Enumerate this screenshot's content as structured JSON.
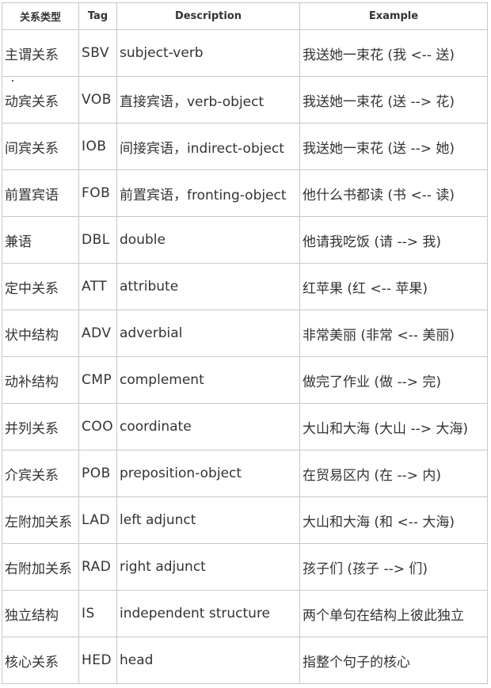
{
  "headers": {
    "name": "关系类型",
    "tag": "Tag",
    "description": "Description",
    "example": "Example"
  },
  "rows": [
    {
      "name": "主谓关系",
      "tag": "SBV",
      "description": "subject-verb",
      "example": "我送她一束花 (我 <-- 送)"
    },
    {
      "name": "动宾关系",
      "tag": "VOB",
      "description": "直接宾语，verb-object",
      "example": "我送她一束花 (送 --> 花)"
    },
    {
      "name": "间宾关系",
      "tag": "IOB",
      "description": "间接宾语，indirect-object",
      "example": "我送她一束花 (送 --> 她)"
    },
    {
      "name": "前置宾语",
      "tag": "FOB",
      "description": "前置宾语，fronting-object",
      "example": "他什么书都读 (书 <-- 读)"
    },
    {
      "name": "兼语",
      "tag": "DBL",
      "description": "double",
      "example": "他请我吃饭 (请 --> 我)"
    },
    {
      "name": "定中关系",
      "tag": "ATT",
      "description": "attribute",
      "example": "红苹果 (红 <-- 苹果)"
    },
    {
      "name": "状中结构",
      "tag": "ADV",
      "description": "adverbial",
      "example": "非常美丽 (非常 <-- 美丽)"
    },
    {
      "name": "动补结构",
      "tag": "CMP",
      "description": "complement",
      "example": "做完了作业 (做 --> 完)"
    },
    {
      "name": "并列关系",
      "tag": "COO",
      "description": "coordinate",
      "example": "大山和大海 (大山 --> 大海)"
    },
    {
      "name": "介宾关系",
      "tag": "POB",
      "description": "preposition-object",
      "example": "在贸易区内 (在 --> 内)"
    },
    {
      "name": "左附加关系",
      "tag": "LAD",
      "description": "left adjunct",
      "example": "大山和大海 (和 <-- 大海)"
    },
    {
      "name": "右附加关系",
      "tag": "RAD",
      "description": "right adjunct",
      "example": "孩子们 (孩子 --> 们)"
    },
    {
      "name": "独立结构",
      "tag": "IS",
      "description": "independent structure",
      "example": "两个单句在结构上彼此独立"
    },
    {
      "name": "核心关系",
      "tag": "HED",
      "description": "head",
      "example": "指整个句子的核心"
    }
  ]
}
